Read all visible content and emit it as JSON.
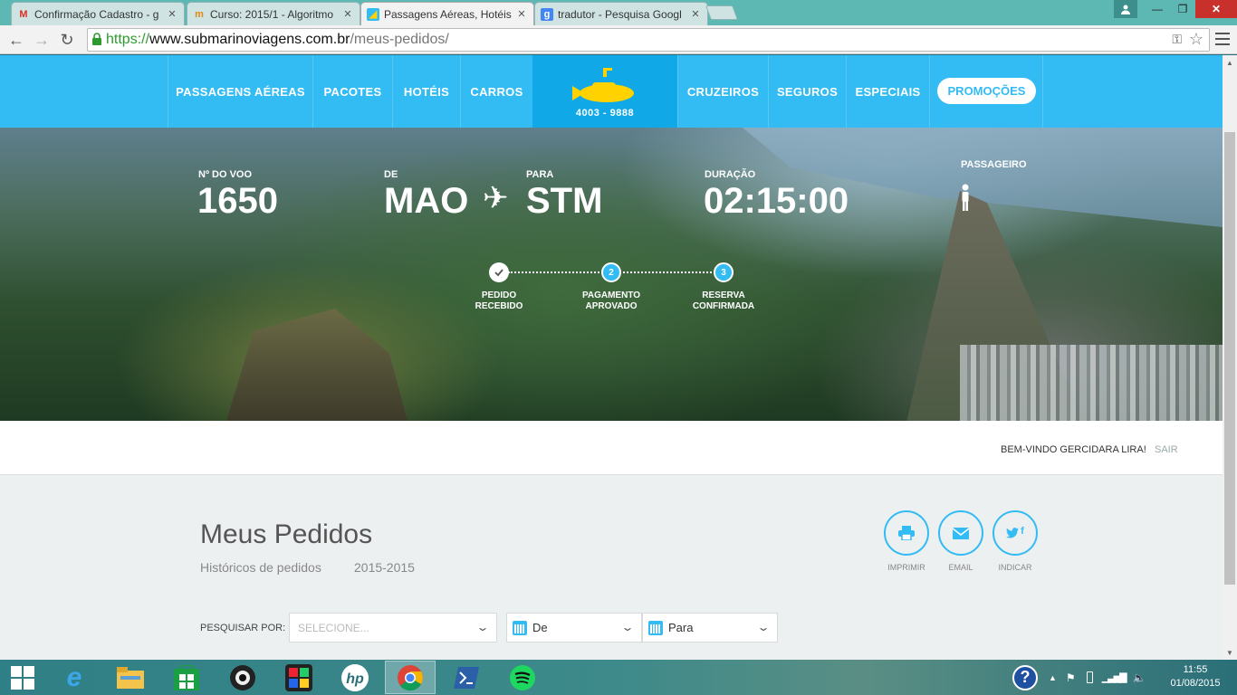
{
  "browser": {
    "tabs": [
      {
        "title": "Confirmação Cadastro - g",
        "icon": "gmail-icon"
      },
      {
        "title": "Curso: 2015/1 - Algoritmo",
        "icon": "moodle-icon"
      },
      {
        "title": "Passagens Aéreas, Hotéis",
        "icon": "submarino-icon",
        "active": true
      },
      {
        "title": "tradutor - Pesquisa Googl",
        "icon": "google-icon"
      }
    ],
    "url": {
      "scheme": "https://",
      "domain": "www.submarinoviagens.com.br",
      "path": "/meus-pedidos/"
    }
  },
  "nav": {
    "items": [
      "PASSAGENS AÉREAS",
      "PACOTES",
      "HOTÉIS",
      "CARROS",
      "CRUZEIROS",
      "SEGUROS",
      "ESPECIAIS"
    ],
    "phone": "4003 - 9888",
    "promo": "PROMOÇÕES"
  },
  "flight": {
    "number_label": "Nº DO VOO",
    "number": "1650",
    "from_label": "DE",
    "from": "MAO",
    "to_label": "PARA",
    "to": "STM",
    "duration_label": "DURAÇÃO",
    "duration": "02:15:00",
    "passenger_label": "PASSAGEIRO"
  },
  "steps": [
    {
      "num": "✓",
      "line1": "PEDIDO",
      "line2": "RECEBIDO",
      "status": "done"
    },
    {
      "num": "2",
      "line1": "PAGAMENTO",
      "line2": "APROVADO",
      "status": "pending"
    },
    {
      "num": "3",
      "line1": "RESERVA",
      "line2": "CONFIRMADA",
      "status": "pending"
    }
  ],
  "welcome": {
    "message": "BEM-VINDO GERCIDARA LIRA!",
    "logout": "SAIR"
  },
  "content": {
    "title": "Meus Pedidos",
    "subtitle": "Históricos de pedidos",
    "period": "2015-2015",
    "actions": [
      {
        "label": "IMPRIMIR",
        "icon": "print-icon"
      },
      {
        "label": "EMAIL",
        "icon": "email-icon"
      },
      {
        "label": "INDICAR",
        "icon": "share-icon"
      }
    ],
    "search_label": "PESQUISAR POR:",
    "select_placeholder": "SELECIONE...",
    "from_select": "De",
    "to_select": "Para"
  },
  "taskbar": {
    "time": "11:55",
    "date": "01/08/2015"
  },
  "colors": {
    "brand": "#33bbf3",
    "logo_bg": "#10a8e6",
    "submarine": "#ffd200"
  }
}
